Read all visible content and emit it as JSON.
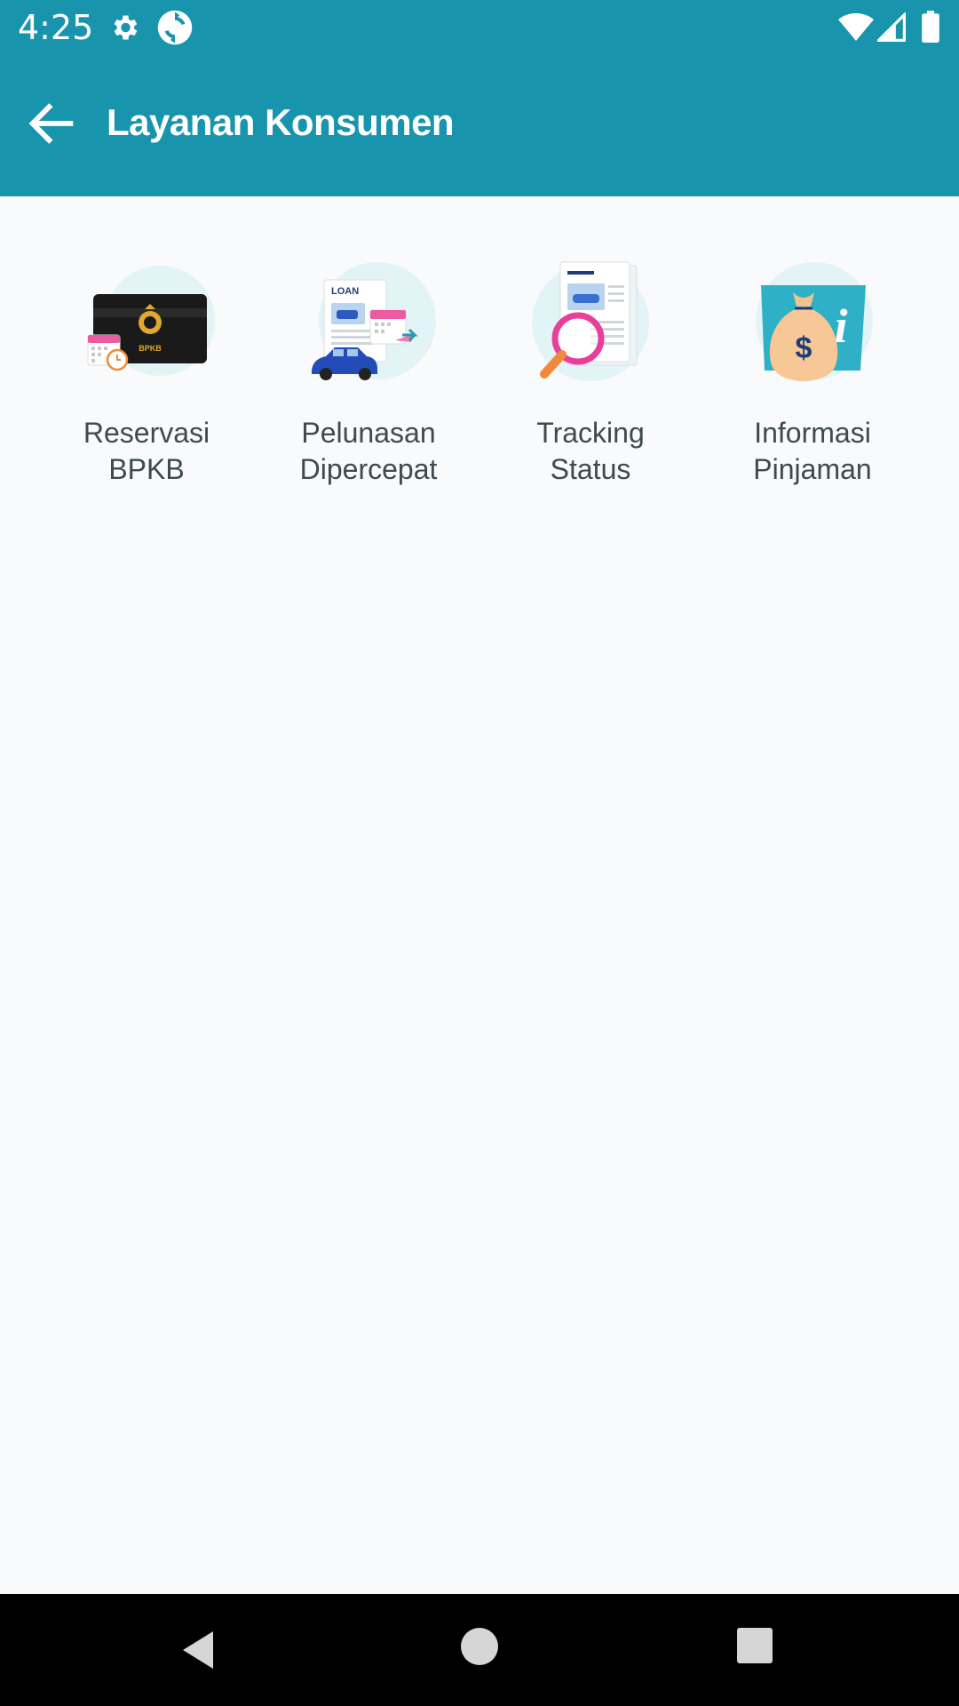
{
  "status_bar": {
    "time": "4:25",
    "icons": [
      "gear-icon",
      "sync-icon",
      "wifi-icon",
      "signal-icon",
      "battery-icon"
    ],
    "background_color": "#1895ad"
  },
  "app_bar": {
    "title": "Layanan Konsumen",
    "back_icon": "arrow-left-icon",
    "background_color": "#1895ad"
  },
  "menu": {
    "items": [
      {
        "line1": "Reservasi",
        "line2": "BPKB",
        "icon": "bpkb-card-icon"
      },
      {
        "line1": "Pelunasan",
        "line2": "Dipercepat",
        "icon": "loan-document-icon"
      },
      {
        "line1": "Tracking",
        "line2": "Status",
        "icon": "magnifier-document-icon"
      },
      {
        "line1": "Informasi",
        "line2": "Pinjaman",
        "icon": "money-bag-info-icon"
      }
    ]
  },
  "card_text": {
    "bpkb": "BPKB",
    "loan": "LOAN"
  },
  "nav_bar": {
    "buttons": [
      "back-triangle-icon",
      "home-circle-icon",
      "recents-square-icon"
    ]
  }
}
